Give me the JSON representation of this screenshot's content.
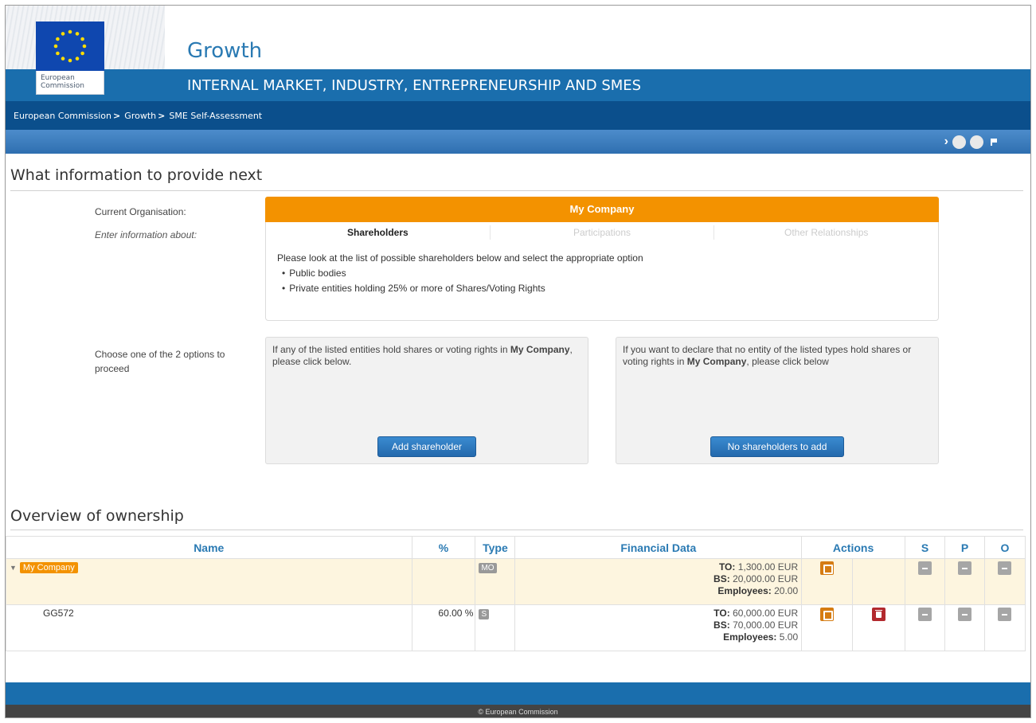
{
  "header": {
    "logo_line1": "European",
    "logo_line2": "Commission",
    "site_title": "Growth",
    "subtitle": "INTERNAL MARKET, INDUSTRY, ENTREPRENEURSHIP AND SMES"
  },
  "breadcrumb": [
    "European Commission",
    "Growth",
    "SME Self-Assessment"
  ],
  "breadcrumb_sep": ">",
  "section1": {
    "title": "What information to provide next",
    "current_org_label": "Current Organisation:",
    "enter_info_label": "Enter information about:",
    "org_name": "My Company",
    "tabs": [
      "Shareholders",
      "Participations",
      "Other Relationships"
    ],
    "active_tab": "Shareholders",
    "instructions": "Please look at the list of possible shareholders below and select the appropriate option",
    "bullets": [
      "Public bodies",
      "Private entities holding 25% or more of Shares/Voting Rights"
    ],
    "choose_label": "Choose one of the 2 options to proceed",
    "option1_pre": "If any of the listed entities hold shares or voting rights in ",
    "option1_bold": "My Company",
    "option1_post": ", please click below.",
    "option1_button": "Add shareholder",
    "option2_pre": "If you want to declare that no entity of the listed types hold shares or voting rights in ",
    "option2_bold": "My Company",
    "option2_post": ", please click below",
    "option2_button": "No shareholders to add"
  },
  "section2": {
    "title": "Overview of ownership",
    "columns": [
      "Name",
      "%",
      "Type",
      "Financial Data",
      "Actions",
      "S",
      "P",
      "O"
    ],
    "rows": [
      {
        "name": "My Company",
        "percent": "",
        "type": "MO",
        "to_label": "TO:",
        "to": "1,300.00 EUR",
        "bs_label": "BS:",
        "bs": "20,000.00 EUR",
        "emp_label": "Employees:",
        "emp": "20.00"
      },
      {
        "name": "GG572",
        "percent": "60.00 %",
        "type": "S",
        "to_label": "TO:",
        "to": "60,000.00 EUR",
        "bs_label": "BS:",
        "bs": "70,000.00 EUR",
        "emp_label": "Employees:",
        "emp": "5.00"
      }
    ]
  },
  "footer": {
    "copyright": "© European Commission"
  },
  "colors": {
    "accent_orange": "#f39200",
    "header_blue": "#1a6ead",
    "crumb_blue": "#0b4f8c",
    "link_blue": "#2a7ab3"
  },
  "icons": [
    "eu-flag-icon",
    "chevron-right-icon",
    "circle-icon",
    "flag-icon",
    "expand-triangle-icon",
    "edit-icon",
    "delete-icon",
    "minus-icon"
  ]
}
